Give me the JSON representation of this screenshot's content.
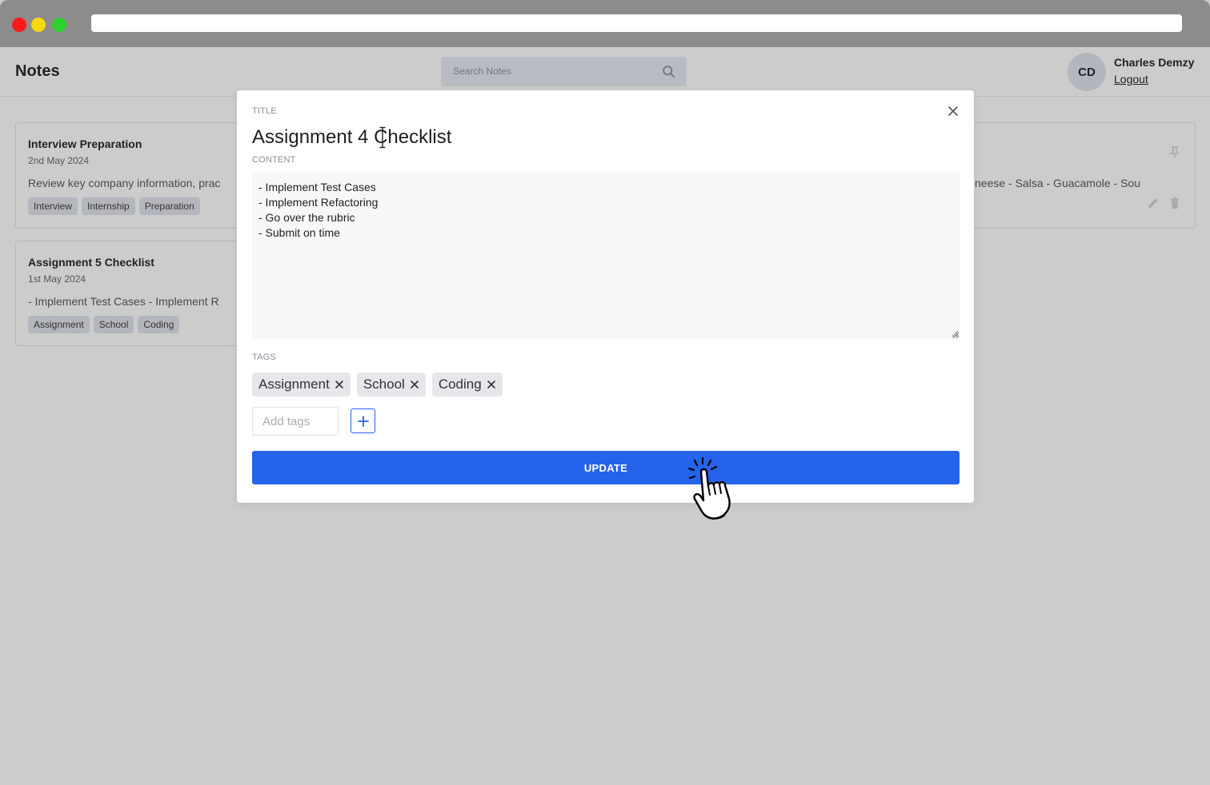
{
  "app": {
    "title": "Notes",
    "search_placeholder": "Search Notes",
    "user": {
      "initials": "CD",
      "name": "Charles Demzy",
      "logout_label": "Logout"
    }
  },
  "notes": [
    {
      "title": "Interview Preparation",
      "date": "2nd May 2024",
      "content": "Review key company information, prac",
      "tags": [
        "Interview",
        "Internship",
        "Preparation"
      ]
    },
    {
      "title": "Assignment 5 Checklist",
      "date": "1st May 2024",
      "content": "- Implement Test Cases - Implement R",
      "tags": [
        "Assignment",
        "School",
        "Coding"
      ]
    },
    {
      "content_tail": "neese - Salsa - Guacamole - Sou"
    }
  ],
  "modal": {
    "title_label": "TITLE",
    "title_value": "Assignment 4 Checklist",
    "content_label": "CONTENT",
    "content_value": "- Implement Test Cases\n- Implement Refactoring\n- Go over the rubric\n- Submit on time",
    "tags_label": "TAGS",
    "tags": [
      "Assignment",
      "School",
      "Coding"
    ],
    "add_tags_placeholder": "Add tags",
    "update_label": "UPDATE"
  },
  "colors": {
    "primary": "#2563eb",
    "backdrop": "#cccccc"
  }
}
